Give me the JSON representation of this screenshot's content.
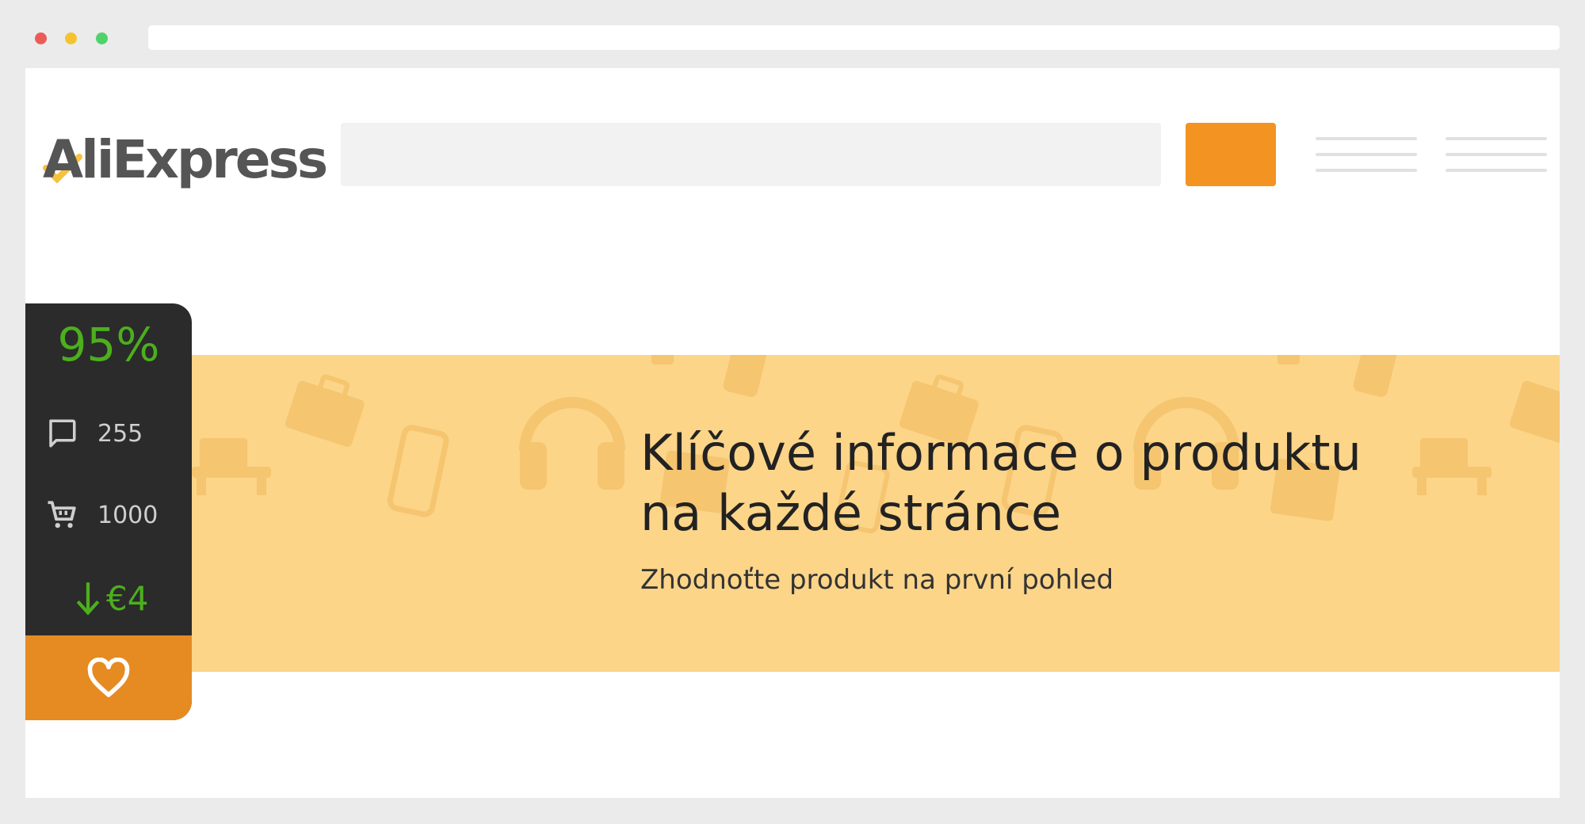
{
  "window": {
    "controls": [
      "close",
      "minimize",
      "maximize"
    ]
  },
  "header": {
    "logo_text": "AliExpress",
    "search_placeholder": "",
    "search_button_icon": "search-icon",
    "menu_icon": "hamburger-icon",
    "colors": {
      "accent": "#f39322",
      "logo": "#555555",
      "logo_check": "#f6c23e"
    }
  },
  "banner": {
    "title_line1": "Klíčové informace o produktu",
    "title_line2": "na každé stránce",
    "subtitle": "Zhodnoťte produkt na první pohled",
    "background": "#fcd589",
    "pattern_icons": [
      "briefcase-icon",
      "phone-icon",
      "headphones-icon",
      "printer-icon",
      "tablet-icon"
    ]
  },
  "widget": {
    "rating": "95%",
    "reviews_icon": "comment-icon",
    "reviews": "255",
    "orders_icon": "cart-icon",
    "orders": "1000",
    "price_icon": "arrow-down-icon",
    "price_drop": "€4",
    "favorite_icon": "heart-icon",
    "colors": {
      "positive": "#4caf1d",
      "panel": "#2b2b2b",
      "favorite": "#e68a22"
    }
  }
}
